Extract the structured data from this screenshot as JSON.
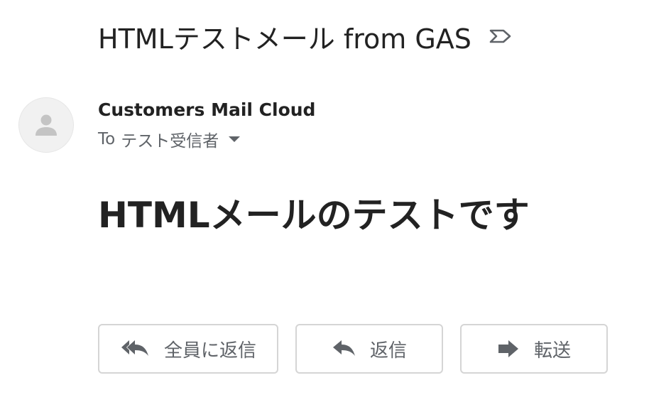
{
  "header": {
    "subject": "HTMLテストメール from GAS",
    "label_icon": "label-outline-icon"
  },
  "sender": {
    "avatar_icon": "person-avatar-icon",
    "name": "Customers Mail Cloud",
    "recipient_prefix": "To",
    "recipient": "テスト受信者"
  },
  "message": {
    "heading": "HTMLメールのテストです"
  },
  "actions": {
    "reply_all_label": "全員に返信",
    "reply_label": "返信",
    "forward_label": "転送"
  },
  "colors": {
    "text_primary": "#222222",
    "text_secondary": "#5f6368",
    "button_border": "#d5d5d5",
    "avatar_bg": "#f1f1f1",
    "avatar_icon": "#c4c4c4"
  }
}
